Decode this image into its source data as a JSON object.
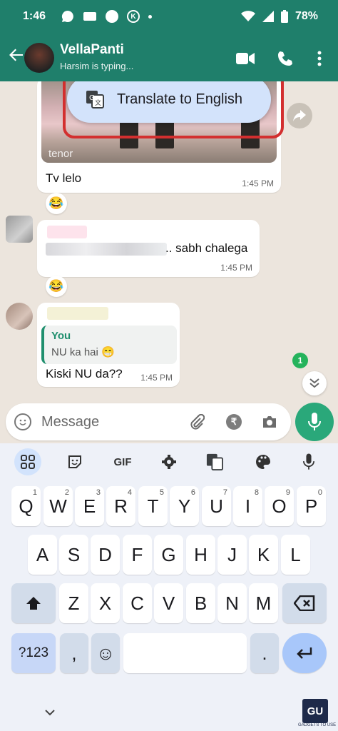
{
  "status_bar": {
    "time": "1:46",
    "battery": "78%",
    "k_label": "K"
  },
  "header": {
    "title": "VellaPanti",
    "subtitle": "Harsim is typing..."
  },
  "messages": [
    {
      "gif_watermark": "tenor",
      "text": "Tv lelo",
      "time": "1:45 PM",
      "reaction": "😂"
    },
    {
      "text": ".. sabh chalega",
      "time": "1:45 PM",
      "reaction": "😂"
    },
    {
      "quote_author": "You",
      "quote_text": "NU ka hai 😁",
      "text": "Kiski NU da??",
      "time": "1:45 PM"
    }
  ],
  "unread_count": "1",
  "translate_popup": {
    "label": "Translate to English"
  },
  "composer": {
    "placeholder": "Message",
    "rupee_symbol": "₹"
  },
  "keyboard": {
    "toolbar": {
      "gif_label": "GIF"
    },
    "row1": [
      {
        "k": "Q",
        "n": "1"
      },
      {
        "k": "W",
        "n": "2"
      },
      {
        "k": "E",
        "n": "3"
      },
      {
        "k": "R",
        "n": "4"
      },
      {
        "k": "T",
        "n": "5"
      },
      {
        "k": "Y",
        "n": "6"
      },
      {
        "k": "U",
        "n": "7"
      },
      {
        "k": "I",
        "n": "8"
      },
      {
        "k": "O",
        "n": "9"
      },
      {
        "k": "P",
        "n": "0"
      }
    ],
    "row2": [
      "A",
      "S",
      "D",
      "F",
      "G",
      "H",
      "J",
      "K",
      "L"
    ],
    "row3": [
      "Z",
      "X",
      "C",
      "V",
      "B",
      "N",
      "M"
    ],
    "symbols_label": "?123",
    "comma_label": ",",
    "period_label": ".",
    "emoji_label": "☺"
  },
  "colors": {
    "header": "#1f7f6b",
    "accent": "#2aa87a",
    "highlight": "#d32f2f"
  },
  "watermark": {
    "logo": "GU",
    "tagline": "GADGETS TO USE"
  }
}
